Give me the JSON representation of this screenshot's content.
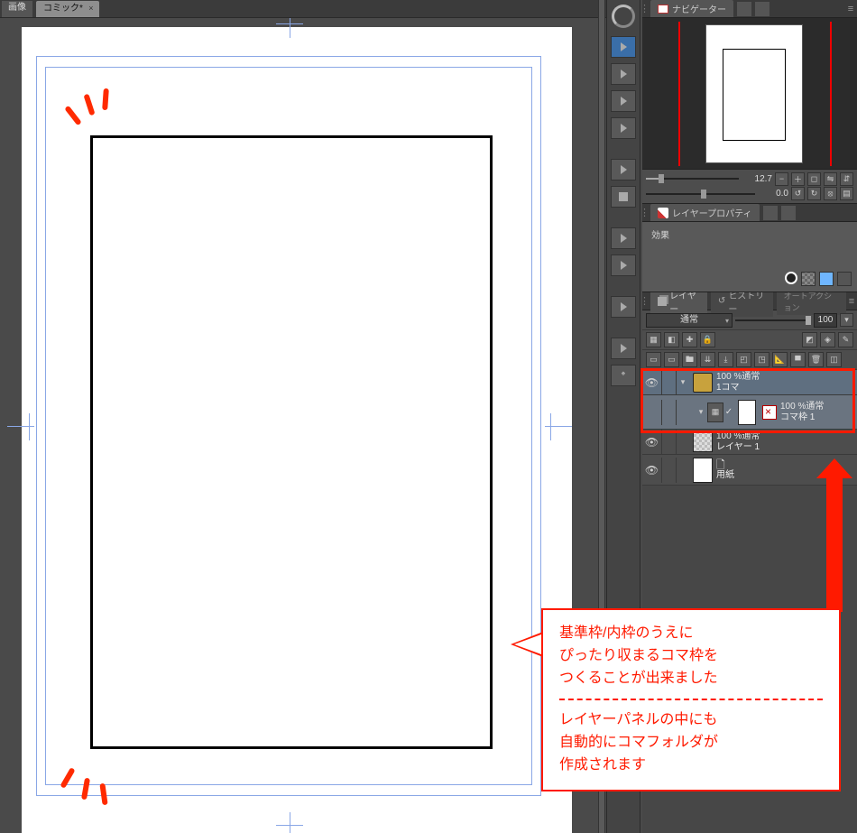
{
  "tab": {
    "icon_label": "画像",
    "title": "コミック*",
    "close": "×",
    "grip": "▸"
  },
  "navigator": {
    "tab_label": "ナビゲーター",
    "zoom_value": "12.7",
    "rotate_value": "0.0"
  },
  "layer_property": {
    "tab_label": "レイヤープロパティ",
    "effect_label": "効果"
  },
  "layer_panel": {
    "tabs": {
      "layer": "レイヤー",
      "history": "ヒストリー",
      "autoaction": "オートアクション"
    },
    "blend_mode": "通常",
    "opacity_value": "100"
  },
  "layers": {
    "folder": {
      "pct": "100 %通常",
      "name": "1コマ"
    },
    "frame": {
      "pct": "100 %通常",
      "name": "コマ枠 1"
    },
    "layer1": {
      "pct": "100 %通常",
      "name": "レイヤー 1"
    },
    "paper": {
      "name": "用紙"
    }
  },
  "callout": {
    "line1": "基準枠/内枠のうえに",
    "line2": "ぴったり収まるコマ枠を",
    "line3": "つくることが出来ました",
    "line4": "レイヤーパネルの中にも",
    "line5": "自動的にコマフォルダが",
    "line6": "作成されます"
  },
  "icons": {
    "zoom_out": "−",
    "zoom_in": "＋",
    "fit": "◻",
    "flip": "⇋",
    "mirror": "⇵",
    "rot_ccw": "↺",
    "rot_cw": "↻",
    "reset": "⦻",
    "eye": "👁",
    "tri_down": "▾",
    "tri_right": "▸",
    "check": "✓",
    "spinner": "▾"
  }
}
